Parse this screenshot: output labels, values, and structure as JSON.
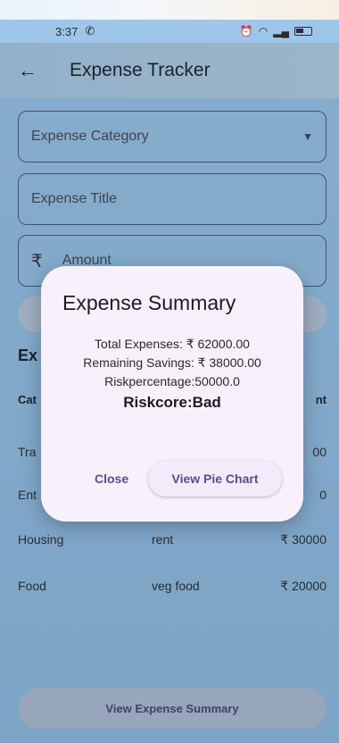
{
  "status": {
    "time": "3:37",
    "whatsapp_icon": "whatsapp-icon",
    "alarm_icon": "alarm-icon"
  },
  "appbar": {
    "title": "Expense Tracker",
    "back_icon": "arrow-back-icon"
  },
  "form": {
    "category_placeholder": "Expense Category",
    "title_placeholder": "Expense Title",
    "currency_symbol": "₹",
    "amount_placeholder": "Amount"
  },
  "section": {
    "title": "Ex"
  },
  "table": {
    "headers": [
      "Cat",
      "nt"
    ],
    "rows": [
      {
        "category": "Tra",
        "description": "",
        "amount": "00"
      },
      {
        "category": "Ent",
        "description": "",
        "amount": "0"
      },
      {
        "category": "Housing",
        "description": "rent",
        "amount": "₹ 30000"
      },
      {
        "category": "Food",
        "description": "veg food",
        "amount": "₹ 20000"
      }
    ]
  },
  "bottom": {
    "summary_button": "View Expense Summary"
  },
  "dialog": {
    "title": "Expense Summary",
    "total": "Total Expenses: ₹ 62000.00",
    "remaining": "Remaining Savings: ₹ 38000.00",
    "riskpercentage": "Riskpercentage:50000.0",
    "riskcore": "Riskcore:Bad",
    "close": "Close",
    "view_pie": "View Pie Chart"
  }
}
